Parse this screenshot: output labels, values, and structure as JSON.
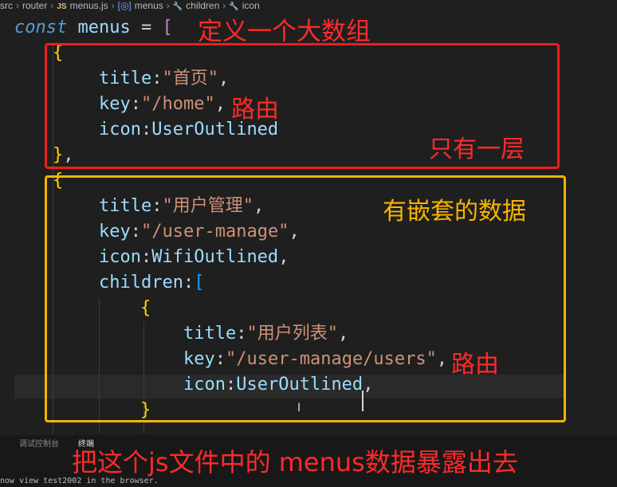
{
  "breadcrumb": {
    "items": [
      "src",
      "router",
      "menus.js",
      "menus",
      "children",
      "icon"
    ],
    "js_badge": "JS"
  },
  "code": {
    "lines": [
      {
        "tokens": [
          [
            "kw",
            "const"
          ],
          [
            "var",
            " menus"
          ],
          [
            "punc",
            " = "
          ],
          [
            "brk1",
            "["
          ]
        ]
      },
      {
        "tokens": [
          [
            "brk2",
            "{"
          ]
        ]
      },
      {
        "tokens": [
          [
            "var",
            "title"
          ],
          [
            "punc",
            ":"
          ],
          [
            "str",
            "\"首页\""
          ],
          [
            "punc",
            ","
          ]
        ]
      },
      {
        "tokens": [
          [
            "var",
            "key"
          ],
          [
            "punc",
            ":"
          ],
          [
            "str",
            "\"/home\""
          ],
          [
            "punc",
            ","
          ]
        ]
      },
      {
        "tokens": [
          [
            "var",
            "icon"
          ],
          [
            "punc",
            ":"
          ],
          [
            "var",
            "UserOutlined"
          ]
        ]
      },
      {
        "tokens": [
          [
            "brk2",
            "}"
          ],
          [
            "punc",
            ","
          ]
        ]
      },
      {
        "tokens": [
          [
            "brk2",
            "{"
          ]
        ]
      },
      {
        "tokens": [
          [
            "var",
            "title"
          ],
          [
            "punc",
            ":"
          ],
          [
            "str",
            "\"用户管理\""
          ],
          [
            "punc",
            ","
          ]
        ]
      },
      {
        "tokens": [
          [
            "var",
            "key"
          ],
          [
            "punc",
            ":"
          ],
          [
            "str",
            "\"/user-manage\""
          ],
          [
            "punc",
            ","
          ]
        ]
      },
      {
        "tokens": [
          [
            "var",
            "icon"
          ],
          [
            "punc",
            ":"
          ],
          [
            "var",
            "WifiOutlined"
          ],
          [
            "punc",
            ","
          ]
        ]
      },
      {
        "tokens": [
          [
            "var",
            "children"
          ],
          [
            "punc",
            ":"
          ],
          [
            "brk3",
            "["
          ]
        ]
      },
      {
        "tokens": [
          [
            "brk2",
            "{"
          ]
        ]
      },
      {
        "tokens": [
          [
            "var",
            "title"
          ],
          [
            "punc",
            ":"
          ],
          [
            "str",
            "\"用户列表\""
          ],
          [
            "punc",
            ","
          ]
        ]
      },
      {
        "tokens": [
          [
            "var",
            "key"
          ],
          [
            "punc",
            ":"
          ],
          [
            "str",
            "\"/user-manage/users\""
          ],
          [
            "punc",
            ","
          ]
        ]
      },
      {
        "tokens": [
          [
            "var",
            "icon"
          ],
          [
            "punc",
            ":"
          ],
          [
            "var",
            "UserOutlined"
          ],
          [
            "punc",
            ","
          ]
        ]
      },
      {
        "tokens": [
          [
            "brk2",
            "}"
          ]
        ]
      }
    ]
  },
  "annotations": {
    "define_array": "定义一个大数组",
    "route1": "路由",
    "single_level": "只有一层",
    "nested_data": "有嵌套的数据",
    "route2": "路由",
    "export_note": "把这个js文件中的 menus数据暴露出去"
  },
  "panel": {
    "tab_debug": "调试控制台",
    "tab_terminal": "终端",
    "terminal_text": "now view test2002 in the browser."
  },
  "colors": {
    "red_annotation": "#ff2a2a",
    "yellow_annotation": "#f7b500",
    "background": "#1f1f1f"
  }
}
